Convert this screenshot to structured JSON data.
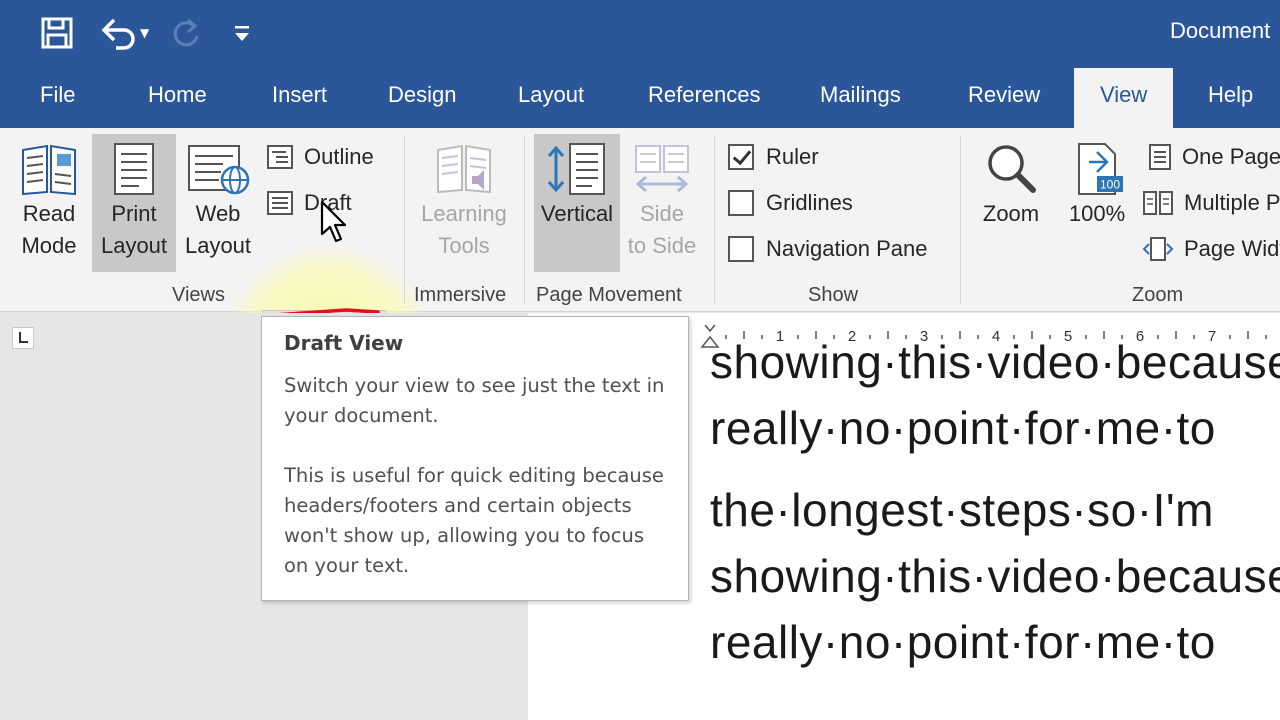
{
  "window": {
    "title": "Document"
  },
  "colors": {
    "brand": "#2b579a",
    "ribbon_bg": "#f3f3f3",
    "annotation_red": "#e3101b",
    "highlight": "#fffd96"
  },
  "tabs": [
    {
      "label": "File"
    },
    {
      "label": "Home"
    },
    {
      "label": "Insert"
    },
    {
      "label": "Design"
    },
    {
      "label": "Layout"
    },
    {
      "label": "References"
    },
    {
      "label": "Mailings"
    },
    {
      "label": "Review"
    },
    {
      "label": "View",
      "active": true
    },
    {
      "label": "Help"
    }
  ],
  "ribbon": {
    "views": {
      "label": "Views",
      "read_mode": [
        "Read",
        "Mode"
      ],
      "print_layout": [
        "Print",
        "Layout"
      ],
      "web_layout": [
        "Web",
        "Layout"
      ],
      "outline": "Outline",
      "draft": "Draft"
    },
    "immersive": {
      "label": "Immersive",
      "learning_tools": [
        "Learning",
        "Tools"
      ]
    },
    "page_movement": {
      "label": "Page Movement",
      "vertical": "Vertical",
      "side_to_side": [
        "Side",
        "to Side"
      ]
    },
    "show": {
      "label": "Show",
      "ruler": {
        "label": "Ruler",
        "checked": true
      },
      "gridlines": {
        "label": "Gridlines",
        "checked": false
      },
      "navigation_pane": {
        "label": "Navigation Pane",
        "checked": false
      }
    },
    "zoom": {
      "label": "Zoom",
      "zoom": "Zoom",
      "hundred": "100%",
      "hundred_badge": "100",
      "one_page": "One Page",
      "multiple_pages": "Multiple Pages",
      "page_width": "Page Width"
    }
  },
  "tooltip": {
    "title": "Draft View",
    "para1": "Switch your view to see just the text in your document.",
    "para2": "This is useful for quick editing because headers/footers and certain objects won't show up, allowing you to focus on your text."
  },
  "ruler": {
    "numbers": [
      "1",
      "2",
      "3",
      "4",
      "5",
      "6",
      "7"
    ]
  },
  "document": {
    "lines": [
      "showing·this·video·because",
      "really·no·point·for·me·to",
      "the·longest·steps·so·I'm",
      "showing·this·video·because",
      "really·no·point·for·me·to"
    ]
  },
  "icons": {
    "save": "save-icon",
    "undo": "undo-icon",
    "redo": "redo-icon",
    "customize": "customize-qat-icon"
  }
}
